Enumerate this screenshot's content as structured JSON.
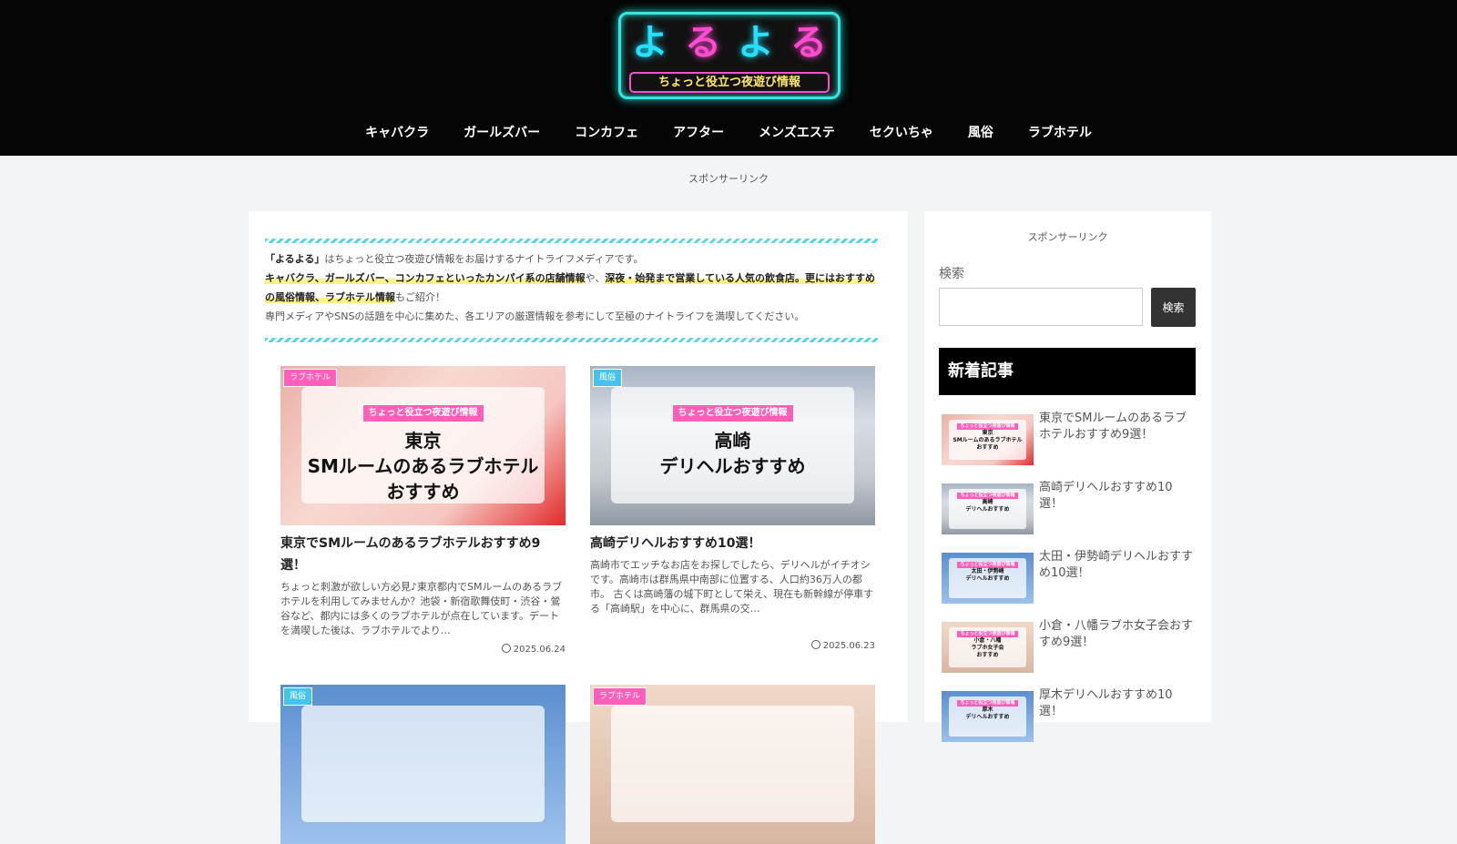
{
  "site": {
    "logo_letters": [
      "よ",
      "る",
      "よ",
      "る"
    ],
    "logo_tagline": "ちょっと役立つ夜遊び情報"
  },
  "nav": [
    "キャバクラ",
    "ガールズバー",
    "コンカフェ",
    "アフター",
    "メンズエステ",
    "セクいちゃ",
    "風俗",
    "ラブホテル"
  ],
  "sponsor_text": "スポンサーリンク",
  "intro": {
    "line1_bold": "「よるよる」",
    "line1_rest": "はちょっと役立つ夜遊び情報をお届けするナイトライフメディアです。",
    "line2_hl1": "キャバクラ、ガールズバー、コンカフェといったカンパイ系の店舗情報",
    "line2_mid": "や、",
    "line2_hl2": "深夜・始発まで営業している人気の飲食店。更にはおすすめの風俗情報、ラブホテル情報",
    "line2_end": "もご紹介！",
    "line3": "専門メディアやSNSの話題を中心に集めた、各エリアの厳選情報を参考にして至極のナイトライフを満喫してください。"
  },
  "cards": [
    {
      "category": "ラブホテル",
      "overlay_tag": "ちょっと役立つ夜遊び情報",
      "overlay_text": "東京\nSMルームのあるラブホテル\nおすすめ",
      "title": "東京でSMルームのあるラブホテルおすすめ9選！",
      "excerpt": "ちょっと刺激が欲しい方必見♪東京都内でSMルームのあるラブホテルを利用してみませんか？池袋・新宿歌舞伎町・渋谷・鶯谷など、都内には多くのラブホテルが点在しています。デートを満喫した後は、ラブホテルでより…",
      "date": "2025.06.24"
    },
    {
      "category": "風俗",
      "overlay_tag": "ちょっと役立つ夜遊び情報",
      "overlay_text": "高崎\nデリヘルおすすめ",
      "title": "高崎デリヘルおすすめ10選！",
      "excerpt": "高崎市でエッチなお店をお探しでしたら、デリヘルがイチオシです。高崎市は群馬県中南部に位置する、人口約36万人の都市。 古くは高崎藩の城下町として栄え、現在も新幹線が停車する「高崎駅」を中心に、群馬県の交…",
      "date": "2025.06.23"
    },
    {
      "category": "風俗"
    },
    {
      "category": "ラブホテル"
    }
  ],
  "sidebar": {
    "search_label": "検索",
    "search_button": "検索",
    "new_posts_heading": "新着記事",
    "posts": [
      {
        "title": "東京でSMルームのあるラブホテルおすすめ9選！",
        "thumb_text": "東京\nSMルームのあるラブホテル\nおすすめ"
      },
      {
        "title": "高崎デリヘルおすすめ10選！",
        "thumb_text": "高崎\nデリヘルおすすめ"
      },
      {
        "title": "太田・伊勢崎デリヘルおすすめ10選！",
        "thumb_text": "太田・伊勢崎\nデリヘルおすすめ"
      },
      {
        "title": "小倉・八幡ラブホ女子会おすすめ9選！",
        "thumb_text": "小倉・八幡\nラブホ女子会\nおすすめ"
      },
      {
        "title": "厚木デリヘルおすすめ10選！",
        "thumb_text": "厚木\nデリヘルおすすめ"
      }
    ],
    "thumb_tag": "ちょっと役立つ夜遊び情報"
  },
  "colors": {
    "header_bg": "#050505",
    "accent_cyan": "#25e0ff",
    "accent_pink": "#ff4ad2",
    "category_pink": "#ff5fb8",
    "category_blue": "#46c3ea",
    "highlight_yellow": "#fff387"
  }
}
